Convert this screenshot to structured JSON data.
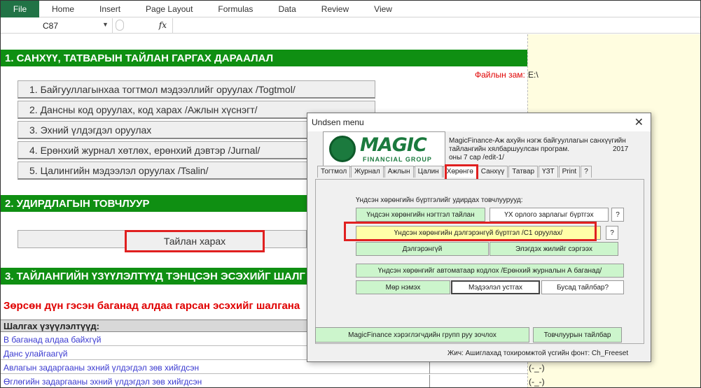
{
  "ribbon": {
    "file_label": "File",
    "tabs": [
      "Home",
      "Insert",
      "Page Layout",
      "Formulas",
      "Data",
      "Review",
      "View"
    ]
  },
  "formula_bar": {
    "cell_ref": "C87",
    "fx_label": "fx"
  },
  "sheet": {
    "section1_title": "1. САНХҮҮ, ТАТВАРЫН ТАЙЛАН ГАРГАХ ДАРААЛАЛ",
    "file_path_label": "Файлын зам:",
    "file_path_value": "E:\\",
    "menu_buttons": [
      "1. Байгууллагынхаа тогтмол мэдээллийг оруулах /Togtmol/",
      "2. Дансны код оруулах, код харах /Ажлын хүснэгт/",
      "3. Эхний үлдэгдэл оруулах",
      "4. Ерөнхий журнал хөтлөх, ерөнхий дэвтэр /Jurnal/",
      "5. Цалингийн мэдээлэл оруулах /Tsalin/"
    ],
    "section2_title": "2. УДИРДЛАГЫН ТОВЧЛУУР",
    "report_button": "Тайлан харах",
    "section3_title": "3. ТАЙЛАНГИЙН ҮЗҮҮЛЭЛТҮҮД ТЭНЦСЭН ЭСЭХИЙГ ШАЛГ",
    "error_note": "Зөрсөн дүн гэсэн баганад алдаа гарсан эсэхийг шалгана",
    "check_header": "Шалгах үзүүлэлтүүд:",
    "check_rows": [
      "В баганад алдаа байхгүй",
      "Данс улайгаагүй",
      "Авлагын задаргааны эхний үлдэгдэл зөв хийгдсэн",
      "Өглөгийн задаргааны эхний үлдэгдэл зөв хийгдсэн"
    ],
    "check_values": [
      "(-_-)",
      "(-_-)"
    ]
  },
  "dialog": {
    "title": "Undsen menu",
    "logo_text": "MAGIC",
    "logo_sub": "FINANCIAL GROUP",
    "description": "MagicFinance-Аж ахуйн нэгж байгууллагын санхүүгийн тайлангийн хялбаршуулсан програм.",
    "version": "оны 7 сар /edit-1/",
    "year": "2017",
    "tabs": [
      "Тогтмол",
      "Журнал",
      "Ажлын",
      "Цалин",
      "Хөрөнгө",
      "Санхүү",
      "Татвар",
      "ҮЗТ",
      "Print",
      "?"
    ],
    "active_tab": "Хөрөнгө",
    "panel_title": "Үндсэн хөрөнгийн бүртгэлийг удирдах товчлуурууд:",
    "buttons": {
      "summary": "Үндсэн хөрөнгийн нэгтгэл тайлан",
      "ux_record": "ҮХ орлого зарлагыг бүртгэх",
      "help1": "?",
      "detailed": "Үндсэн хөрөнгийн дэлгэрэнгүй бүртгэл /С1 оруулах/",
      "help2": "?",
      "detail": "Дэлгэрэнгүй",
      "life": "Элэгдэх жилийг сэргээх",
      "auto_calc": "Үндсэн хөрөнгийг автоматаар кодлох /Ерөнхий журналын А баганад/",
      "add_row": "Мөр нэмэх",
      "clear": "Мэдээлэл устгах",
      "other": "Бусад тайлбар?",
      "group": "MagicFinance хэрэглэгчдийн групп руу зочлох",
      "button_help": "Товчлуурын тайлбар"
    },
    "footnote": "Жич: Ашиглахад тохиромжтой үсгийн фонт: Ch_Freeset"
  }
}
